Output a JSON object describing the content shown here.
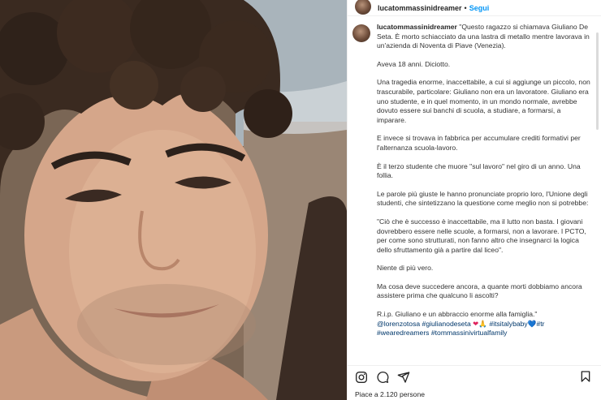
{
  "header": {
    "username": "lucatommassinidreamer",
    "separator": "•",
    "follow_label": "Segui"
  },
  "caption": {
    "username": "lucatommassinidreamer",
    "p1": "\"Questo ragazzo si chiamava Giuliano De Seta. È morto schiacciato da una lastra di metallo mentre lavorava in un'azienda di Noventa di Piave (Venezia).",
    "p2": "Aveva 18 anni. Diciotto.",
    "p3": "Una tragedia enorme, inaccettabile, a cui si aggiunge un piccolo, non trascurabile, particolare: Giuliano non era un lavoratore. Giuliano era uno studente, e in quel momento, in un mondo normale, avrebbe dovuto essere sui banchi di scuola, a studiare, a formarsi, a imparare.",
    "p4": "E invece si trovava in fabbrica per accumulare crediti formativi per l'alternanza scuola-lavoro.",
    "p5": "È il terzo studente che muore \"sul lavoro\" nel giro di un anno. Una follia.",
    "p6": "Le parole più giuste le hanno pronunciate proprio loro, l'Unione degli studenti, che sintetizzano la questione come meglio non si potrebbe:",
    "p7": "\"Ciò che è successo è inaccettabile, ma il lutto non basta. I giovani dovrebbero essere nelle scuole, a formarsi, non a lavorare. I PCTO, per come sono strutturati, non fanno altro che insegnarci la logica dello sfruttamento già a partire dal liceo\".",
    "p8": "Niente di più vero.",
    "p9": "Ma cosa deve succedere ancora, a quante morti dobbiamo ancora assistere prima che qualcuno li ascolti?",
    "p10": "R.i.p. Giuliano e un abbraccio enorme alla famiglia.\"",
    "tags_1": "@lorenzotosa #giulianodeseta",
    "heart": "❤",
    "pray": "🙏",
    "tags_2": "#itsitalybaby",
    "blueheart": "💙",
    "tags_3": "#tr",
    "tags_4": "#wearedreamers #tommassinivirtualfamily"
  },
  "actions": {
    "icons": [
      "instagram-icon",
      "comment-icon",
      "share-icon",
      "bookmark-icon"
    ]
  },
  "likes": {
    "text": "Piace a 2.120 persone"
  },
  "colors": {
    "link_blue": "#0095f6",
    "hashtag": "#00376b",
    "heart_red": "#e0245e",
    "heart_blue": "#1d6fd8"
  }
}
